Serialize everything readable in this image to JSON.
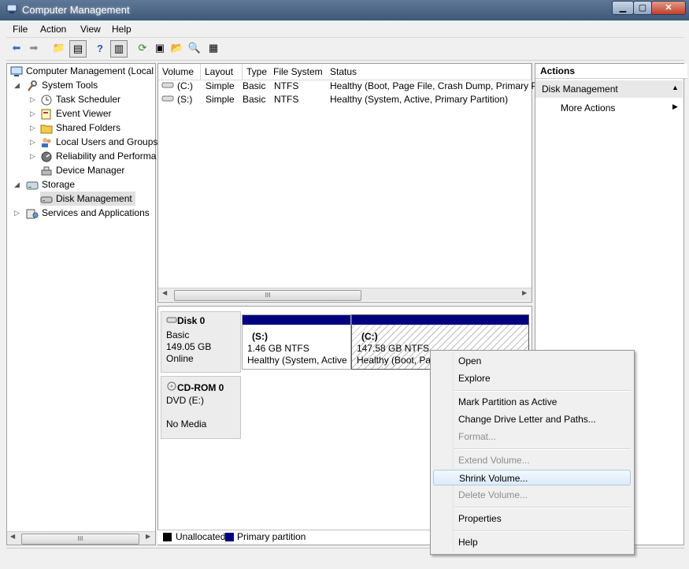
{
  "window": {
    "title": "Computer Management",
    "min_label": "▁",
    "max_label": "▢",
    "close_label": "✕"
  },
  "menu": [
    "File",
    "Action",
    "View",
    "Help"
  ],
  "tree": {
    "root": "Computer Management (Local",
    "system_tools": "System Tools",
    "task_scheduler": "Task Scheduler",
    "event_viewer": "Event Viewer",
    "shared_folders": "Shared Folders",
    "local_users": "Local Users and Groups",
    "reliability": "Reliability and Performa",
    "device_manager": "Device Manager",
    "storage": "Storage",
    "disk_management": "Disk Management",
    "services": "Services and Applications"
  },
  "volume_table": {
    "headers": [
      "Volume",
      "Layout",
      "Type",
      "File System",
      "Status"
    ],
    "rows": [
      [
        "(C:)",
        "Simple",
        "Basic",
        "NTFS",
        "Healthy (Boot, Page File, Crash Dump, Primary P"
      ],
      [
        "(S:)",
        "Simple",
        "Basic",
        "NTFS",
        "Healthy (System, Active, Primary Partition)"
      ]
    ]
  },
  "disks": {
    "disk0": {
      "name": "Disk 0",
      "type": "Basic",
      "size": "149.05 GB",
      "status": "Online"
    },
    "cdrom0": {
      "name": "CD-ROM 0",
      "type": "DVD (E:)",
      "status": "No Media"
    }
  },
  "partitions": {
    "s": {
      "label": "(S:)",
      "size": "1.46 GB NTFS",
      "status": "Healthy (System, Active"
    },
    "c": {
      "label": "(C:)",
      "size": "147.58 GB NTFS",
      "status": "Healthy (Boot, Pa"
    }
  },
  "legend": {
    "unallocated": "Unallocated",
    "primary": "Primary partition"
  },
  "actions": {
    "title": "Actions",
    "disk_management": "Disk Management",
    "more_actions": "More Actions"
  },
  "context_menu": {
    "open": "Open",
    "explore": "Explore",
    "mark_active": "Mark Partition as Active",
    "change_letter": "Change Drive Letter and Paths...",
    "format": "Format...",
    "extend": "Extend Volume...",
    "shrink": "Shrink Volume...",
    "delete": "Delete Volume...",
    "properties": "Properties",
    "help": "Help"
  },
  "scroll_grip": "III",
  "colors": {
    "primary_partition": "#000080",
    "unallocated": "#000000",
    "title_bar": "#4a6283"
  }
}
